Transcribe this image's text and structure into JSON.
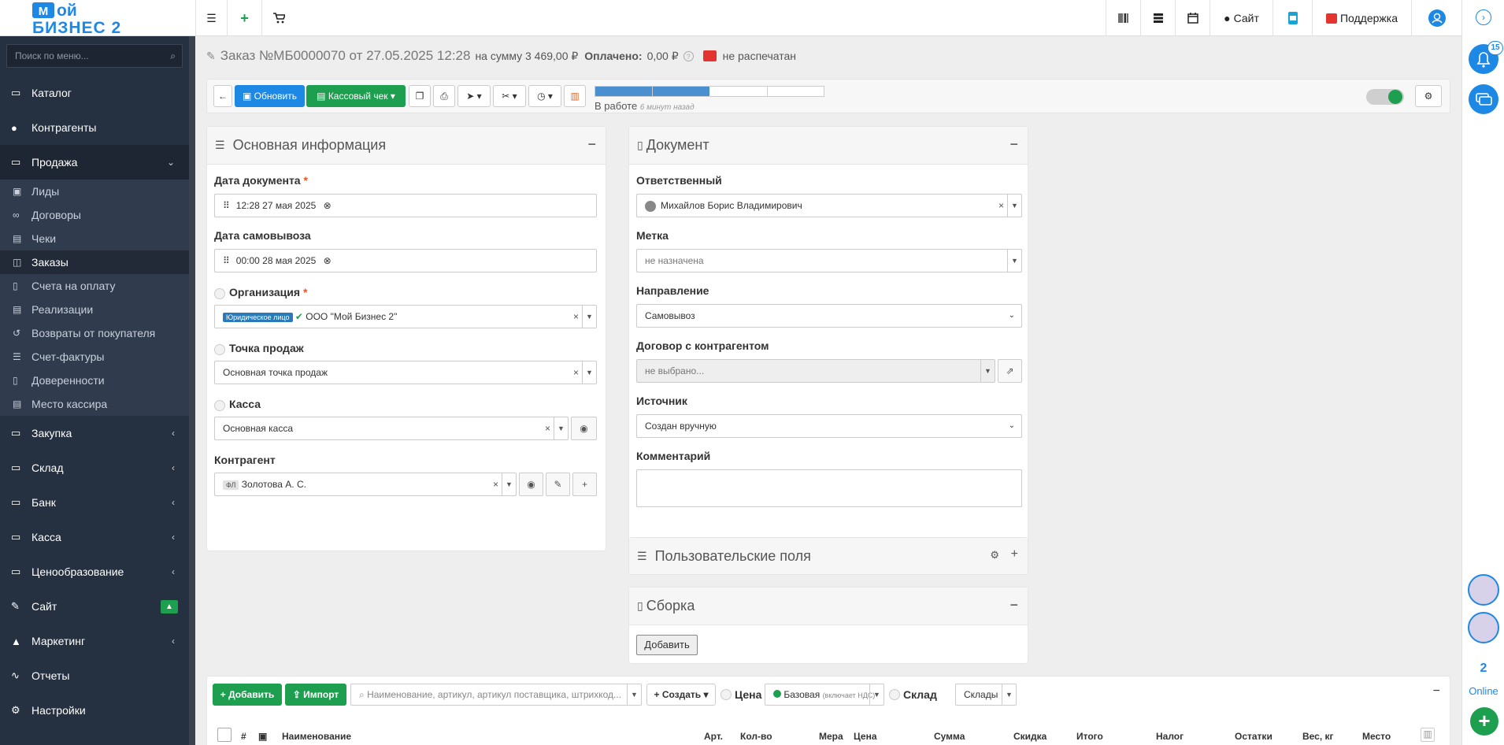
{
  "brand": {
    "logo_text": "Мой Бизнес 2"
  },
  "topbar": {
    "site": "Сайт",
    "support": "Поддержка"
  },
  "sidebar": {
    "search_placeholder": "Поиск по меню...",
    "items": [
      {
        "label": "Каталог"
      },
      {
        "label": "Контрагенты"
      },
      {
        "label": "Продажа"
      },
      {
        "label": "Закупка"
      },
      {
        "label": "Склад"
      },
      {
        "label": "Банк"
      },
      {
        "label": "Касса"
      },
      {
        "label": "Ценообразование"
      },
      {
        "label": "Сайт"
      },
      {
        "label": "Маркетинг"
      },
      {
        "label": "Отчеты"
      },
      {
        "label": "Настройки"
      }
    ],
    "sub": [
      {
        "label": "Лиды"
      },
      {
        "label": "Договоры"
      },
      {
        "label": "Чеки"
      },
      {
        "label": "Заказы"
      },
      {
        "label": "Счета на оплату"
      },
      {
        "label": "Реализации"
      },
      {
        "label": "Возвраты от покупателя"
      },
      {
        "label": "Счет-фактуры"
      },
      {
        "label": "Доверенности"
      },
      {
        "label": "Место кассира"
      }
    ]
  },
  "header": {
    "title": "Заказ №МБ0000070 от 27.05.2025 12:28",
    "sum_label": "на сумму 3 469,00 ₽",
    "paid_label": "Оплачено:",
    "paid_value": "0,00 ₽",
    "print_status": "не распечатан"
  },
  "toolbar": {
    "refresh": "Обновить",
    "receipt": "Кассовый чек",
    "status": "В работе",
    "status_time": "6 минут назад",
    "progress": 0.5
  },
  "main_info": {
    "title": "Основная информация",
    "doc_date_label": "Дата документа",
    "doc_date": "12:28 27 мая 2025",
    "pickup_label": "Дата самовывоза",
    "pickup_date": "00:00 28 мая 2025",
    "org_label": "Организация",
    "org_badge": "Юридическое лицо",
    "org_value": "ООО \"Мой Бизнес 2\"",
    "pos_label": "Точка продаж",
    "pos_value": "Основная точка продаж",
    "cash_label": "Касса",
    "cash_value": "Основная касса",
    "contractor_label": "Контрагент",
    "contractor_badge": "ФЛ",
    "contractor_value": "Золотова А. С."
  },
  "document": {
    "title": "Документ",
    "resp_label": "Ответственный",
    "resp_value": "Михайлов Борис Владимирович",
    "tag_label": "Метка",
    "tag_value": "не назначена",
    "dir_label": "Направление",
    "dir_value": "Самовывоз",
    "contract_label": "Договор с контрагентом",
    "contract_value": "не выбрано...",
    "source_label": "Источник",
    "source_value": "Создан вручную",
    "comment_label": "Комментарий"
  },
  "custom_fields": {
    "title": "Пользовательские поля"
  },
  "assembly": {
    "title": "Сборка",
    "add": "Добавить"
  },
  "goods": {
    "add": "Добавить",
    "import": "Импорт",
    "search_placeholder": "Наименование, артикул, артикул поставщика, штрихкод...",
    "create": "Создать",
    "price_label": "Цена",
    "price_value": "Базовая",
    "price_note": "(включает НДС)",
    "warehouse_label": "Склад",
    "warehouse_value": "Склады",
    "columns": [
      "#",
      "Наименование",
      "Арт.",
      "Кол-во",
      "Мера",
      "Цена",
      "Сумма",
      "Скидка",
      "Итого",
      "Налог",
      "Остатки",
      "Вес, кг",
      "Место"
    ]
  },
  "right": {
    "notifications": "15",
    "online_count": "2",
    "online_label": "Online"
  },
  "colors": {
    "primary": "#1e88e5",
    "green": "#1e9e4f",
    "sidebar": "#253041"
  }
}
